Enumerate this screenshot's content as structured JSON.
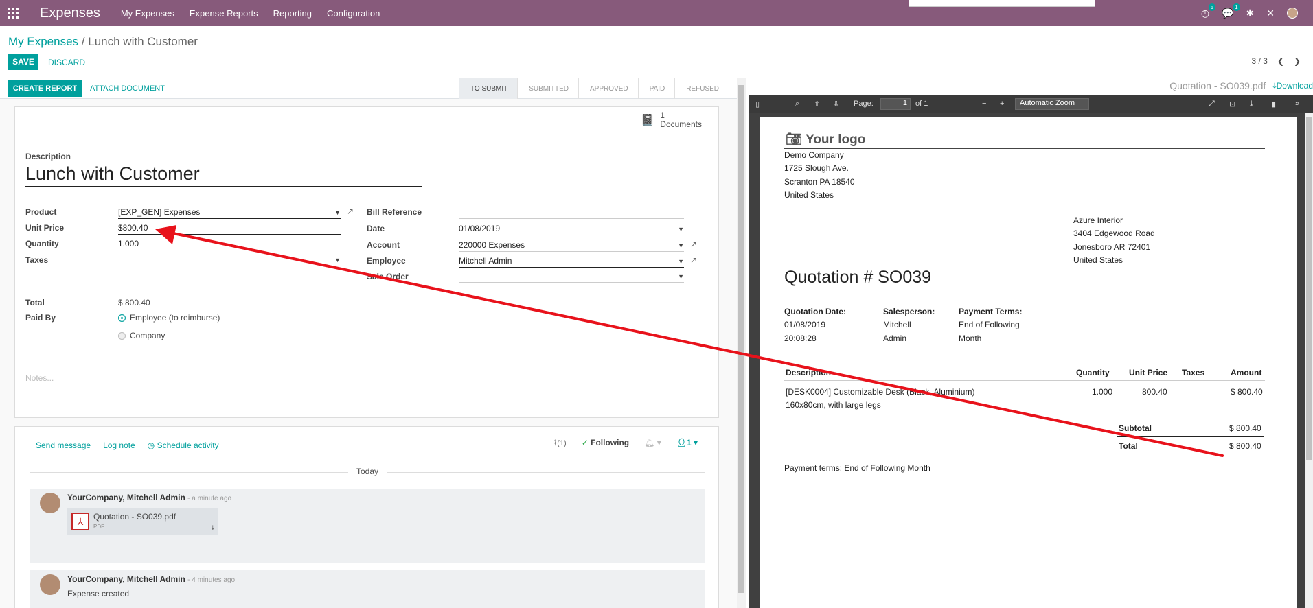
{
  "topbar": {
    "app_name": "Expenses",
    "menu": [
      "My Expenses",
      "Expense Reports",
      "Reporting",
      "Configuration"
    ],
    "activity_count": "5",
    "message_count": "1"
  },
  "breadcrumb": {
    "parent": "My Expenses",
    "separator": "/",
    "current": "Lunch with Customer"
  },
  "buttons": {
    "save": "SAVE",
    "discard": "DISCARD",
    "create_report": "CREATE REPORT",
    "attach_document": "ATTACH DOCUMENT"
  },
  "pager": {
    "value": "3 / 3"
  },
  "statusbar": [
    "TO SUBMIT",
    "SUBMITTED",
    "APPROVED",
    "PAID",
    "REFUSED"
  ],
  "documents": {
    "count": "1",
    "label": "Documents"
  },
  "form": {
    "description_label": "Description",
    "description": "Lunch with Customer",
    "product_label": "Product",
    "product": "[EXP_GEN] Expenses",
    "unit_price_label": "Unit Price",
    "unit_price": "$800.40",
    "quantity_label": "Quantity",
    "quantity": "1.000",
    "taxes_label": "Taxes",
    "taxes": "",
    "bill_ref_label": "Bill Reference",
    "bill_ref": "",
    "date_label": "Date",
    "date": "01/08/2019",
    "account_label": "Account",
    "account": "220000 Expenses",
    "employee_label": "Employee",
    "employee": "Mitchell Admin",
    "sale_order_label": "Sale Order",
    "sale_order": "",
    "total_label": "Total",
    "total": "$ 800.40",
    "paid_by_label": "Paid By",
    "paid_by_options": [
      "Employee (to reimburse)",
      "Company"
    ],
    "notes_placeholder": "Notes..."
  },
  "chatter": {
    "send_message": "Send message",
    "log_note": "Log note",
    "schedule_activity": "Schedule activity",
    "attachments_count": "(1)",
    "following": "Following",
    "followers": "1",
    "today": "Today",
    "messages": [
      {
        "author": "YourCompany, Mitchell Admin",
        "time": "- a minute ago",
        "attachment": "Quotation - SO039.pdf",
        "attachment_type": "PDF"
      },
      {
        "author": "YourCompany, Mitchell Admin",
        "time": "- 4 minutes ago",
        "body": "Expense created"
      }
    ]
  },
  "pdf": {
    "filename": "Quotation - SO039.pdf",
    "download": "Download",
    "toolbar": {
      "page_label": "Page:",
      "page": "1",
      "of": "of 1",
      "zoom": "Automatic Zoom"
    },
    "logo": "Your logo",
    "company_lines": [
      "Demo Company",
      "1725 Slough Ave.",
      "Scranton PA 18540",
      "United States"
    ],
    "customer_lines": [
      "Azure Interior",
      "3404 Edgewood Road",
      "Jonesboro AR 72401",
      "United States"
    ],
    "title": "Quotation # SO039",
    "info": [
      {
        "label": "Quotation Date:",
        "lines": [
          "01/08/2019",
          "20:08:28"
        ]
      },
      {
        "label": "Salesperson:",
        "lines": [
          "Mitchell",
          "Admin"
        ]
      },
      {
        "label": "Payment Terms:",
        "lines": [
          "End of Following",
          "Month"
        ]
      }
    ],
    "table_headers": [
      "Description",
      "Quantity",
      "Unit Price",
      "Taxes",
      "Amount"
    ],
    "line": {
      "description_1": "[DESK0004] Customizable Desk (Black, Aluminium)",
      "description_2": "160x80cm, with large legs",
      "quantity": "1.000",
      "unit_price": "800.40",
      "amount": "$ 800.40"
    },
    "subtotal_label": "Subtotal",
    "subtotal": "$ 800.40",
    "total_label": "Total",
    "total": "$ 800.40",
    "payment_terms": "Payment terms: End of Following Month"
  },
  "colors": {
    "header": "#875a7b",
    "primary": "#00A09D",
    "annotation_arrow": "#e8121b"
  }
}
